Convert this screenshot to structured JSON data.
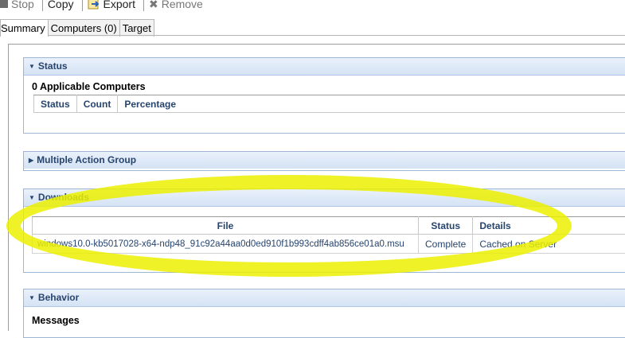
{
  "toolbar": {
    "stop": "Stop",
    "copy": "Copy",
    "export": "Export",
    "remove": "Remove"
  },
  "tabs": [
    "Summary",
    "Computers (0)",
    "Target"
  ],
  "sections": {
    "status": {
      "title": "Status",
      "applicable": "0 Applicable Computers",
      "columns": [
        "Status",
        "Count",
        "Percentage"
      ]
    },
    "mag": {
      "title": "Multiple Action Group"
    },
    "downloads": {
      "title": "Downloads",
      "columns": [
        "File",
        "Status",
        "Details"
      ],
      "rows": [
        [
          "windows10.0-kb5017028-x64-ndp48_91c92a44aa0d0ed910f1b993cdff4ab856ce01a0.msu",
          "Complete",
          "Cached on Server"
        ]
      ]
    },
    "behavior": {
      "title": "Behavior",
      "messages": "Messages"
    }
  },
  "colors": {
    "highlight": "#ebf000",
    "header_text": "#27446e"
  }
}
